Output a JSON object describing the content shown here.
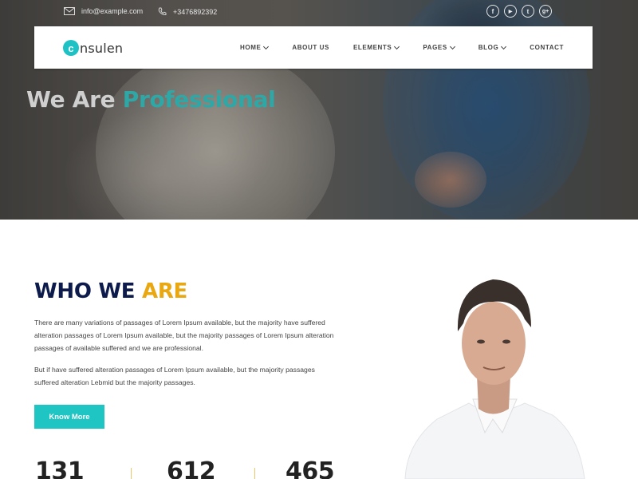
{
  "topbar": {
    "email": "info@example.com",
    "phone": "+3476892392",
    "socials": [
      {
        "name": "facebook-icon",
        "glyph": "f"
      },
      {
        "name": "youtube-icon",
        "glyph": "▶"
      },
      {
        "name": "twitter-icon",
        "glyph": "t"
      },
      {
        "name": "google-plus-icon",
        "glyph": "g+"
      }
    ]
  },
  "brand": {
    "logo_letter": "c",
    "logo_text": "nsulen",
    "accent": "#1fc2c4"
  },
  "nav": {
    "items": [
      {
        "label": "HOME",
        "dropdown": true
      },
      {
        "label": "ABOUT US",
        "dropdown": false
      },
      {
        "label": "ELEMENTS",
        "dropdown": true
      },
      {
        "label": "PAGES",
        "dropdown": true
      },
      {
        "label": "BLOG",
        "dropdown": true
      },
      {
        "label": "CONTACT",
        "dropdown": false
      }
    ]
  },
  "hero": {
    "title_part1": "We Are",
    "title_part2": "Professional"
  },
  "about": {
    "title_part1": "WHO WE",
    "title_part2": "ARE",
    "paragraph1": "There are many variations of passages of Lorem Ipsum available, but the majority have suffered alteration passages of Lorem Ipsum available, but the majority passages of Lorem Ipsum alteration passages of available suffered and we are professional.",
    "paragraph2": "But if have suffered alteration passages of Lorem Ipsum available, but the majority passages suffered alteration Lebmid but the majority passages.",
    "button_label": "Know More",
    "colors": {
      "title_dark": "#0d1b4c",
      "title_accent": "#e9a811",
      "button": "#1fc5c3"
    }
  },
  "stats": [
    "131",
    "612",
    "465"
  ]
}
